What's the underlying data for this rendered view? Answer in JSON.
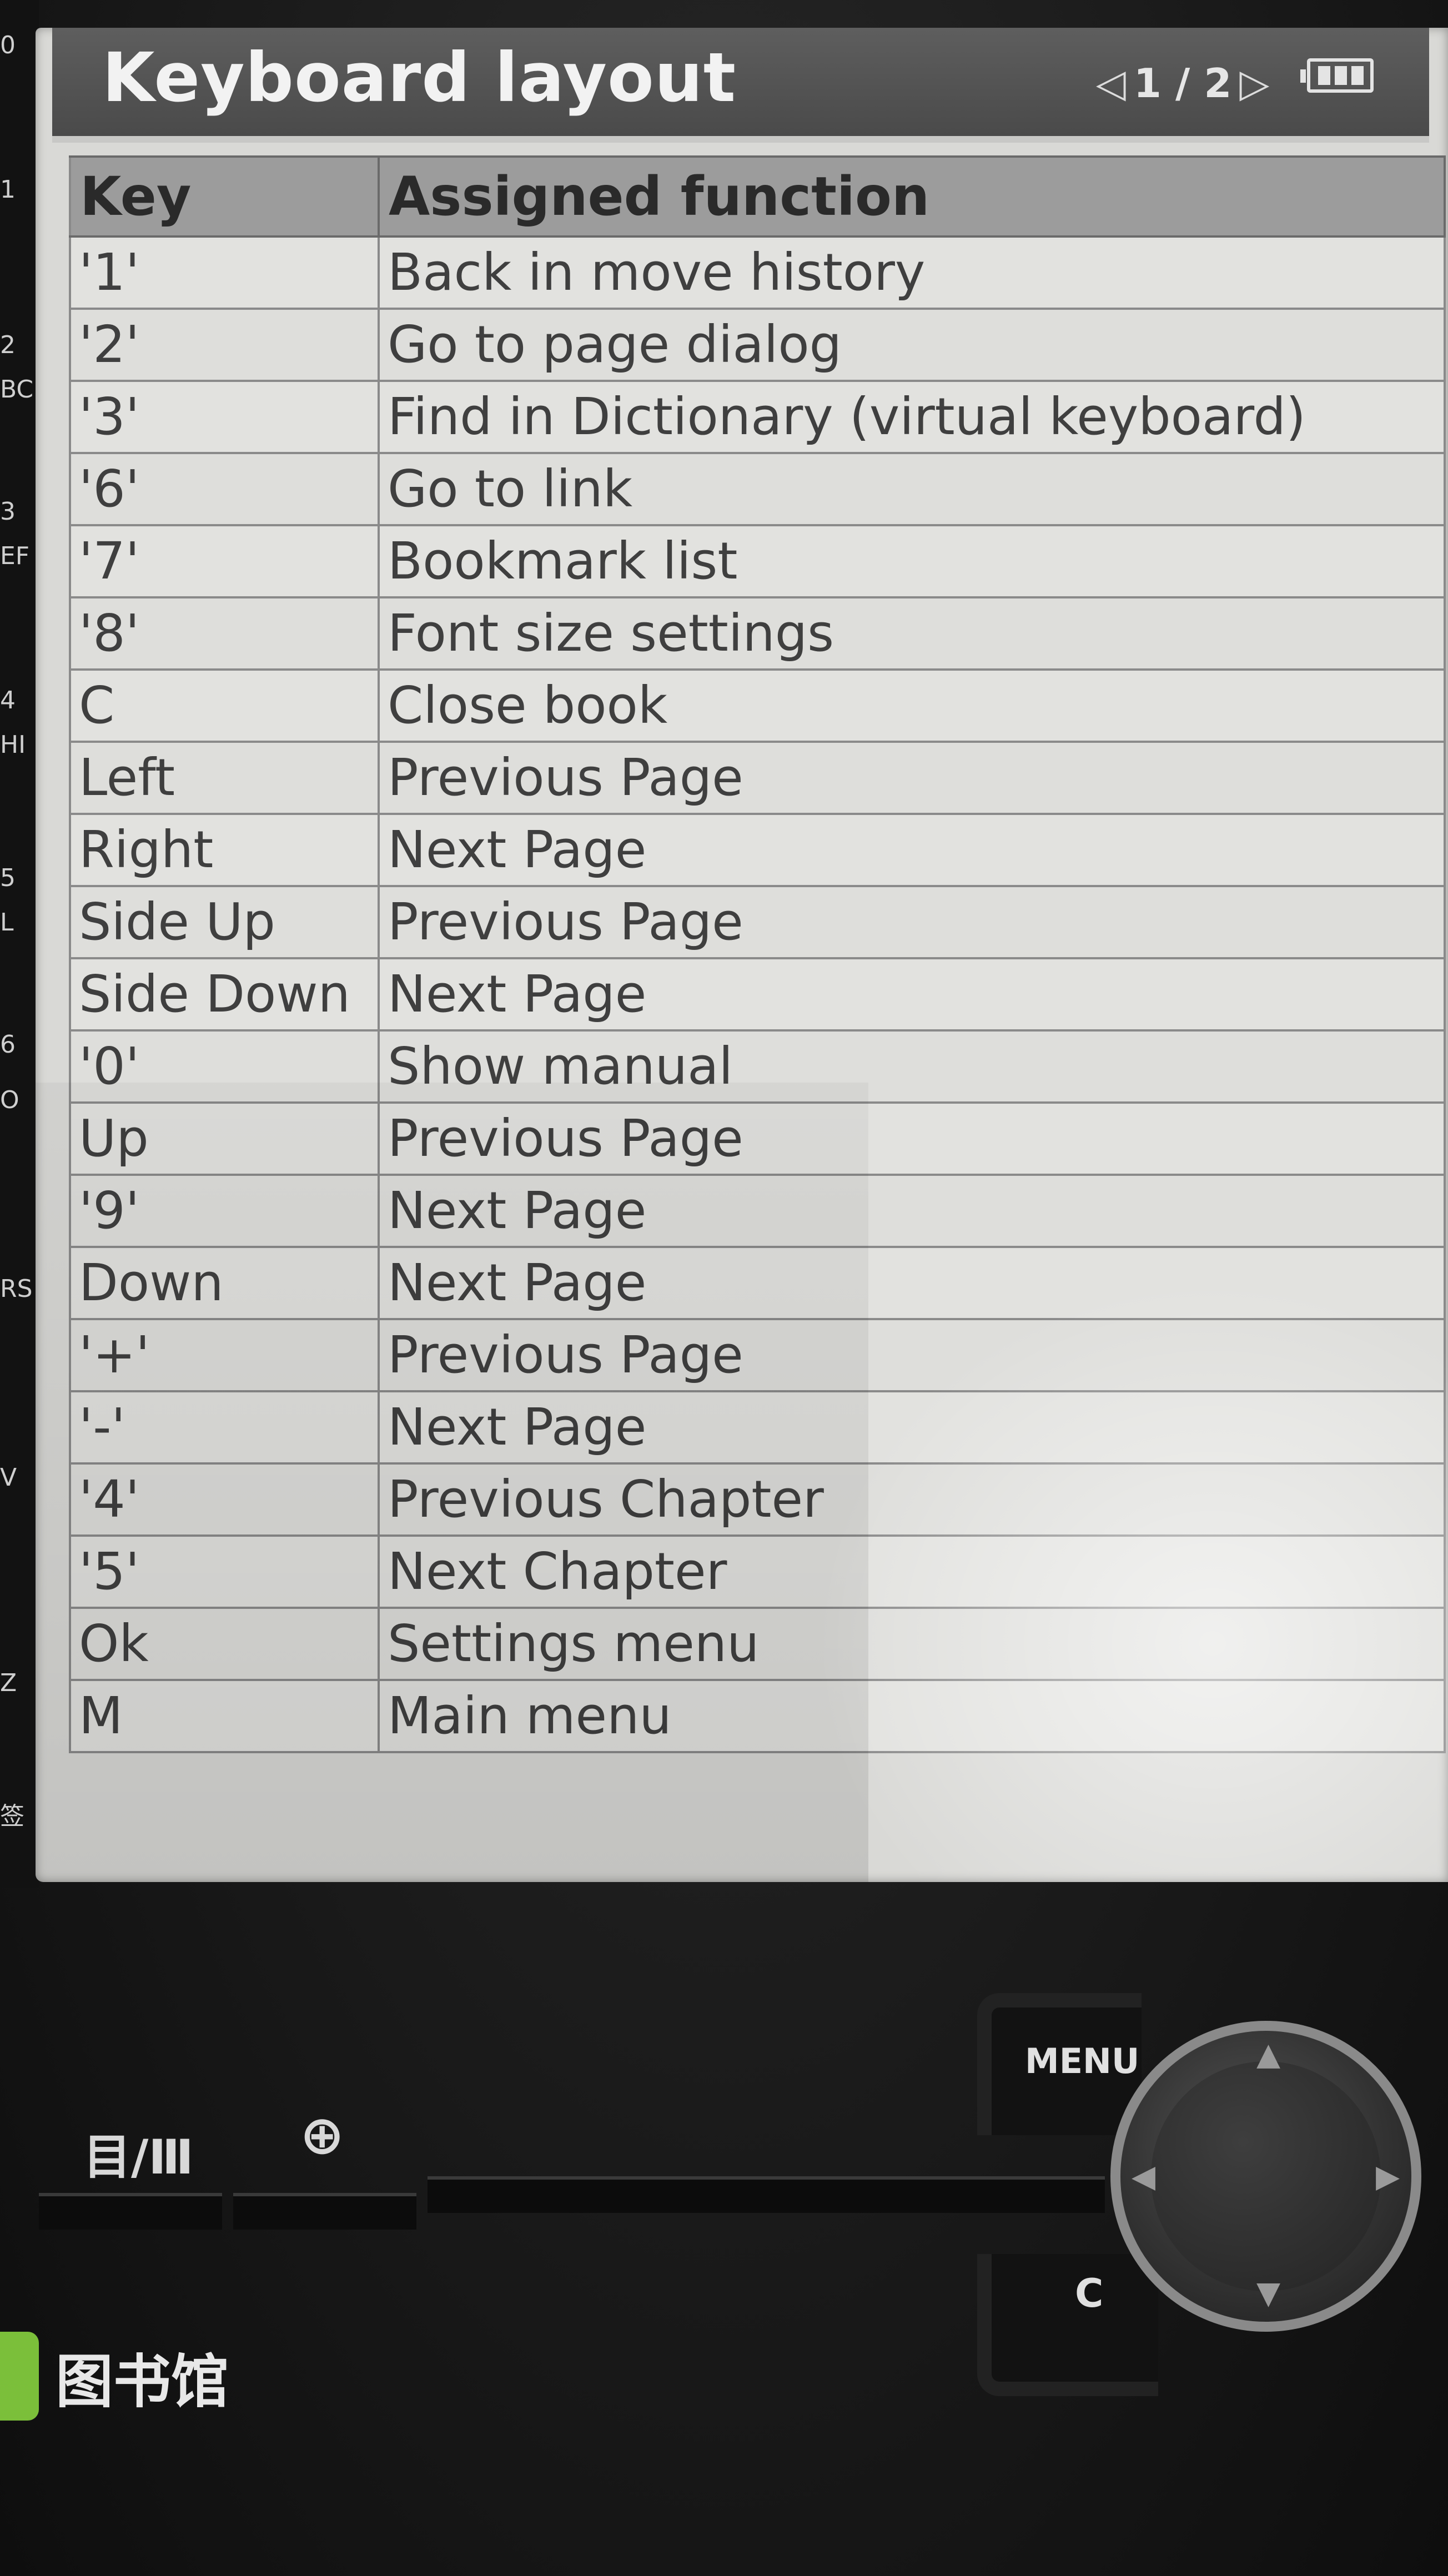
{
  "window": {
    "title": "Keyboard layout",
    "page_indicator": "1 / 2"
  },
  "table": {
    "headers": [
      "Key",
      "Assigned function"
    ],
    "rows": [
      [
        "'1'",
        "Back in move history"
      ],
      [
        "'2'",
        "Go to page dialog"
      ],
      [
        "'3'",
        "Find in Dictionary (virtual keyboard)"
      ],
      [
        "'6'",
        "Go to link"
      ],
      [
        "'7'",
        "Bookmark list"
      ],
      [
        "'8'",
        "Font size settings"
      ],
      [
        "C",
        "Close book"
      ],
      [
        "Left",
        "Previous Page"
      ],
      [
        "Right",
        "Next Page"
      ],
      [
        "Side Up",
        "Previous Page"
      ],
      [
        "Side Down",
        "Next Page"
      ],
      [
        "'0'",
        "Show manual"
      ],
      [
        "Up",
        "Previous Page"
      ],
      [
        "'9'",
        "Next Page"
      ],
      [
        "Down",
        "Next Page"
      ],
      [
        "'+'",
        "Previous Page"
      ],
      [
        "'-'",
        "Next Page"
      ],
      [
        "'4'",
        "Previous Chapter"
      ],
      [
        "'5'",
        "Next Chapter"
      ],
      [
        "Ok",
        "Settings menu"
      ],
      [
        "M",
        "Main menu"
      ]
    ]
  },
  "device": {
    "menu_key_label": "MENU",
    "c_key_label": "C",
    "toc_label": "目/Ⅲ",
    "brand_text": "图书馆",
    "left_strip_chars": [
      "0",
      "1",
      "2",
      "BC",
      "3",
      "EF",
      "4",
      "HI",
      "5",
      "L",
      "6",
      "O",
      "RS",
      "V",
      "Z",
      "签"
    ]
  },
  "colors": {
    "titlebar": "#4a4a4a",
    "screen_bg": "#d9d9d6",
    "header_row": "#9c9c9c",
    "brand_green": "#7bbf3a"
  },
  "icons": [
    "prev-page-icon",
    "next-page-icon",
    "battery-icon",
    "zoom-icon",
    "dpad-up-icon",
    "dpad-down-icon",
    "dpad-left-icon",
    "dpad-right-icon"
  ]
}
